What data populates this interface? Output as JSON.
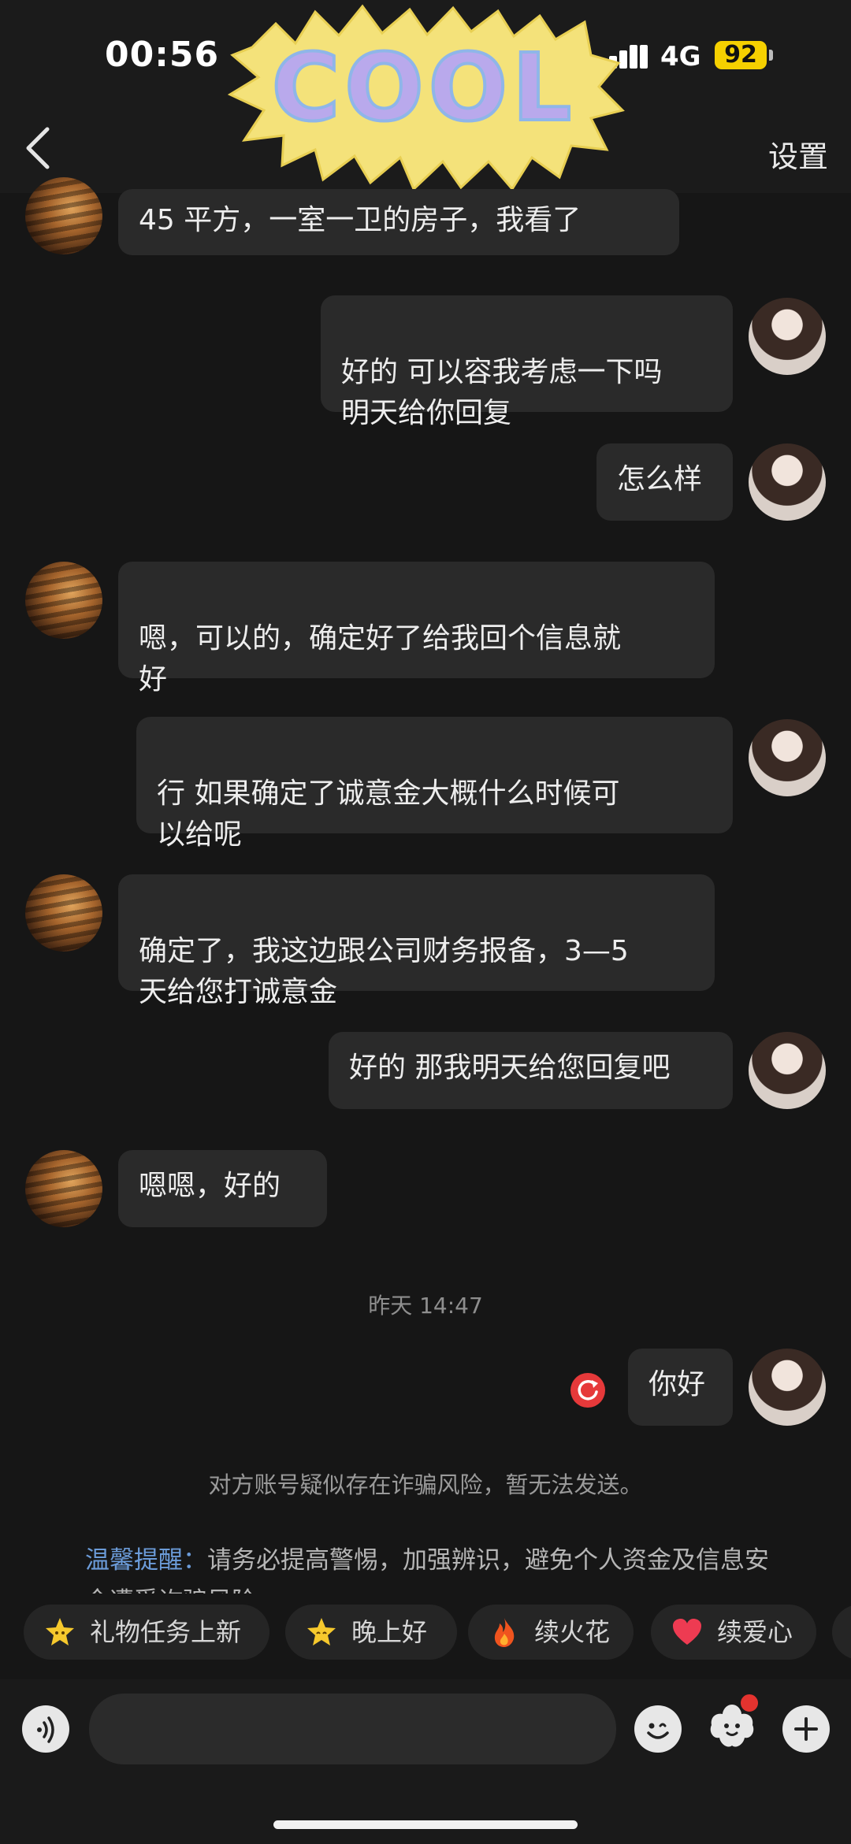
{
  "status_bar": {
    "time": "00:56",
    "network": "4G",
    "battery": "92"
  },
  "header": {
    "settings_label": "设置",
    "sticker_text": "COOL"
  },
  "messages": [
    {
      "side": "left",
      "text": "45 平方，一室一卫的房子，我看了"
    },
    {
      "side": "right",
      "text": "好的 可以容我考虑一下吗\n明天给你回复"
    },
    {
      "side": "right",
      "text": "怎么样"
    },
    {
      "side": "left",
      "text": "嗯，可以的，确定好了给我回个信息就\n好"
    },
    {
      "side": "right",
      "text": "行 如果确定了诚意金大概什么时候可\n以给呢"
    },
    {
      "side": "left",
      "text": "确定了，我这边跟公司财务报备，3—5\n天给您打诚意金"
    },
    {
      "side": "right",
      "text": "好的 那我明天给您回复吧"
    },
    {
      "side": "left",
      "text": "嗯嗯，好的"
    },
    {
      "side": "right",
      "text": "你好"
    }
  ],
  "time_separator": "昨天 14:47",
  "system_notice": "对方账号疑似存在诈骗风险，暂无法发送。",
  "warning": {
    "title": "温馨提醒：",
    "body": "请务必提高警惕，加强辨识，避免个人资金及信息安全遭受诈骗风险。"
  },
  "quick_replies": [
    {
      "label": "礼物任务上新",
      "icon": "star-face-icon"
    },
    {
      "label": "晚上好",
      "icon": "star-face-icon"
    },
    {
      "label": "续火花",
      "icon": "fire-icon"
    },
    {
      "label": "续爱心",
      "icon": "heart-icon"
    }
  ],
  "colors": {
    "background": "#161616",
    "bubble": "#2a2a2a",
    "alert": "#e6393a",
    "warning_title": "#6b9bd8",
    "battery": "#f5d000"
  }
}
